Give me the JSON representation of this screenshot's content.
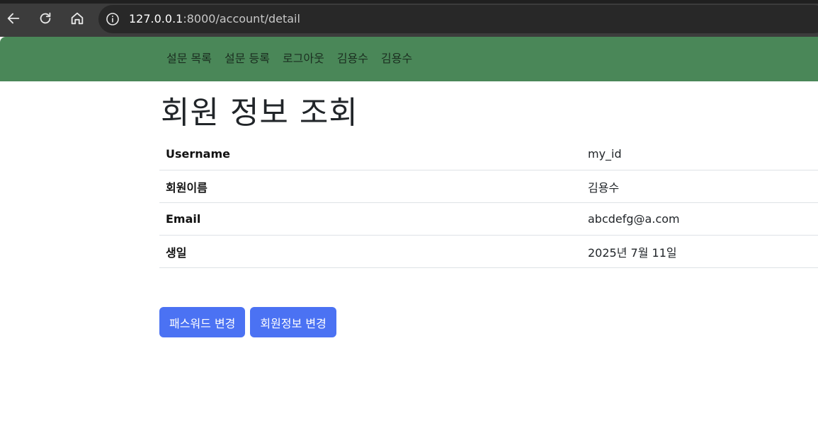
{
  "browser": {
    "url_host": "127.0.0.1",
    "url_rest": ":8000/account/detail",
    "back_icon": "arrow-left-icon",
    "reload_icon": "reload-icon",
    "home_icon": "home-icon",
    "info_icon": "info-icon"
  },
  "navbar": {
    "links": [
      {
        "label": "설문 목록"
      },
      {
        "label": "설문 등록"
      },
      {
        "label": "로그아웃"
      },
      {
        "label": "김용수"
      },
      {
        "label": "김용수"
      }
    ]
  },
  "page": {
    "title": "회원 정보 조회"
  },
  "details": [
    {
      "label": "Username",
      "value": "my_id"
    },
    {
      "label": "회원이름",
      "value": "김용수"
    },
    {
      "label": "Email",
      "value": "abcdefg@a.com"
    },
    {
      "label": "생일",
      "value": "2025년 7월 11일"
    }
  ],
  "actions": {
    "change_password_label": "패스워드 변경",
    "change_info_label": "회원정보 변경"
  },
  "colors": {
    "navbar_bg": "#4a8758",
    "button_bg": "#4b72f3",
    "browser_bar": "#3c3c3c"
  }
}
